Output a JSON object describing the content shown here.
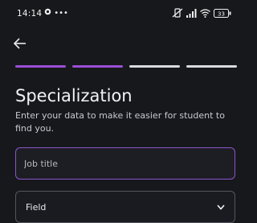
{
  "status_bar": {
    "time": "14:14",
    "left_extra": "•••",
    "battery_level": "33",
    "icons": [
      "mute-vibrate-icon",
      "signal-icon",
      "wifi-icon",
      "battery-icon"
    ]
  },
  "header": {
    "back_icon": "arrow-left-icon"
  },
  "progress": {
    "total_steps": 4,
    "current_step": 2
  },
  "page": {
    "title": "Specialization",
    "subtitle": "Enter your data to make it easier for student to find you."
  },
  "form": {
    "job_title_placeholder": "Job title",
    "job_title_value": "",
    "field_label": "Field"
  },
  "colors": {
    "accent": "#9b4fd6",
    "background": "#17181c"
  }
}
